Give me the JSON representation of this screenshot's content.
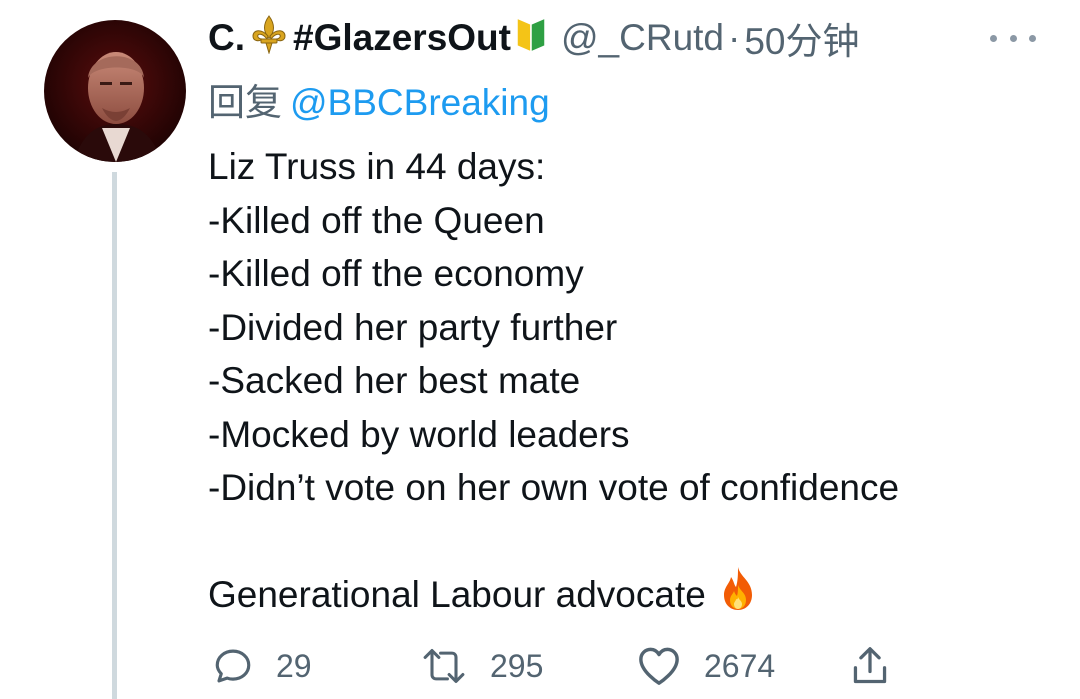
{
  "tweet": {
    "author": {
      "display_name_prefix": "C.",
      "display_name_hashtag": "#GlazersOut",
      "handle": "@_CRutd",
      "emoji_icons": [
        "fleur-de-lis-icon",
        "beginner-badge-icon"
      ]
    },
    "dot_separator": "·",
    "timestamp": "50分钟",
    "reply_prefix": "回复",
    "reply_to": "@BBCBreaking",
    "text_lines": [
      "Liz Truss in 44 days:",
      "-Killed off the Queen",
      "-Killed off the economy",
      "-Divided her party further",
      "-Sacked her best mate",
      "-Mocked by world leaders",
      "-Didn’t vote on her own vote of confidence",
      "",
      "Generational Labour advocate"
    ],
    "trailing_emoji": "fire-icon",
    "actions": {
      "reply_count": "29",
      "retweet_count": "295",
      "like_count": "2674"
    }
  },
  "colors": {
    "text": "#0f1419",
    "secondary": "#536471",
    "link": "#1d9bf0",
    "thread_line": "#cfd9de"
  }
}
